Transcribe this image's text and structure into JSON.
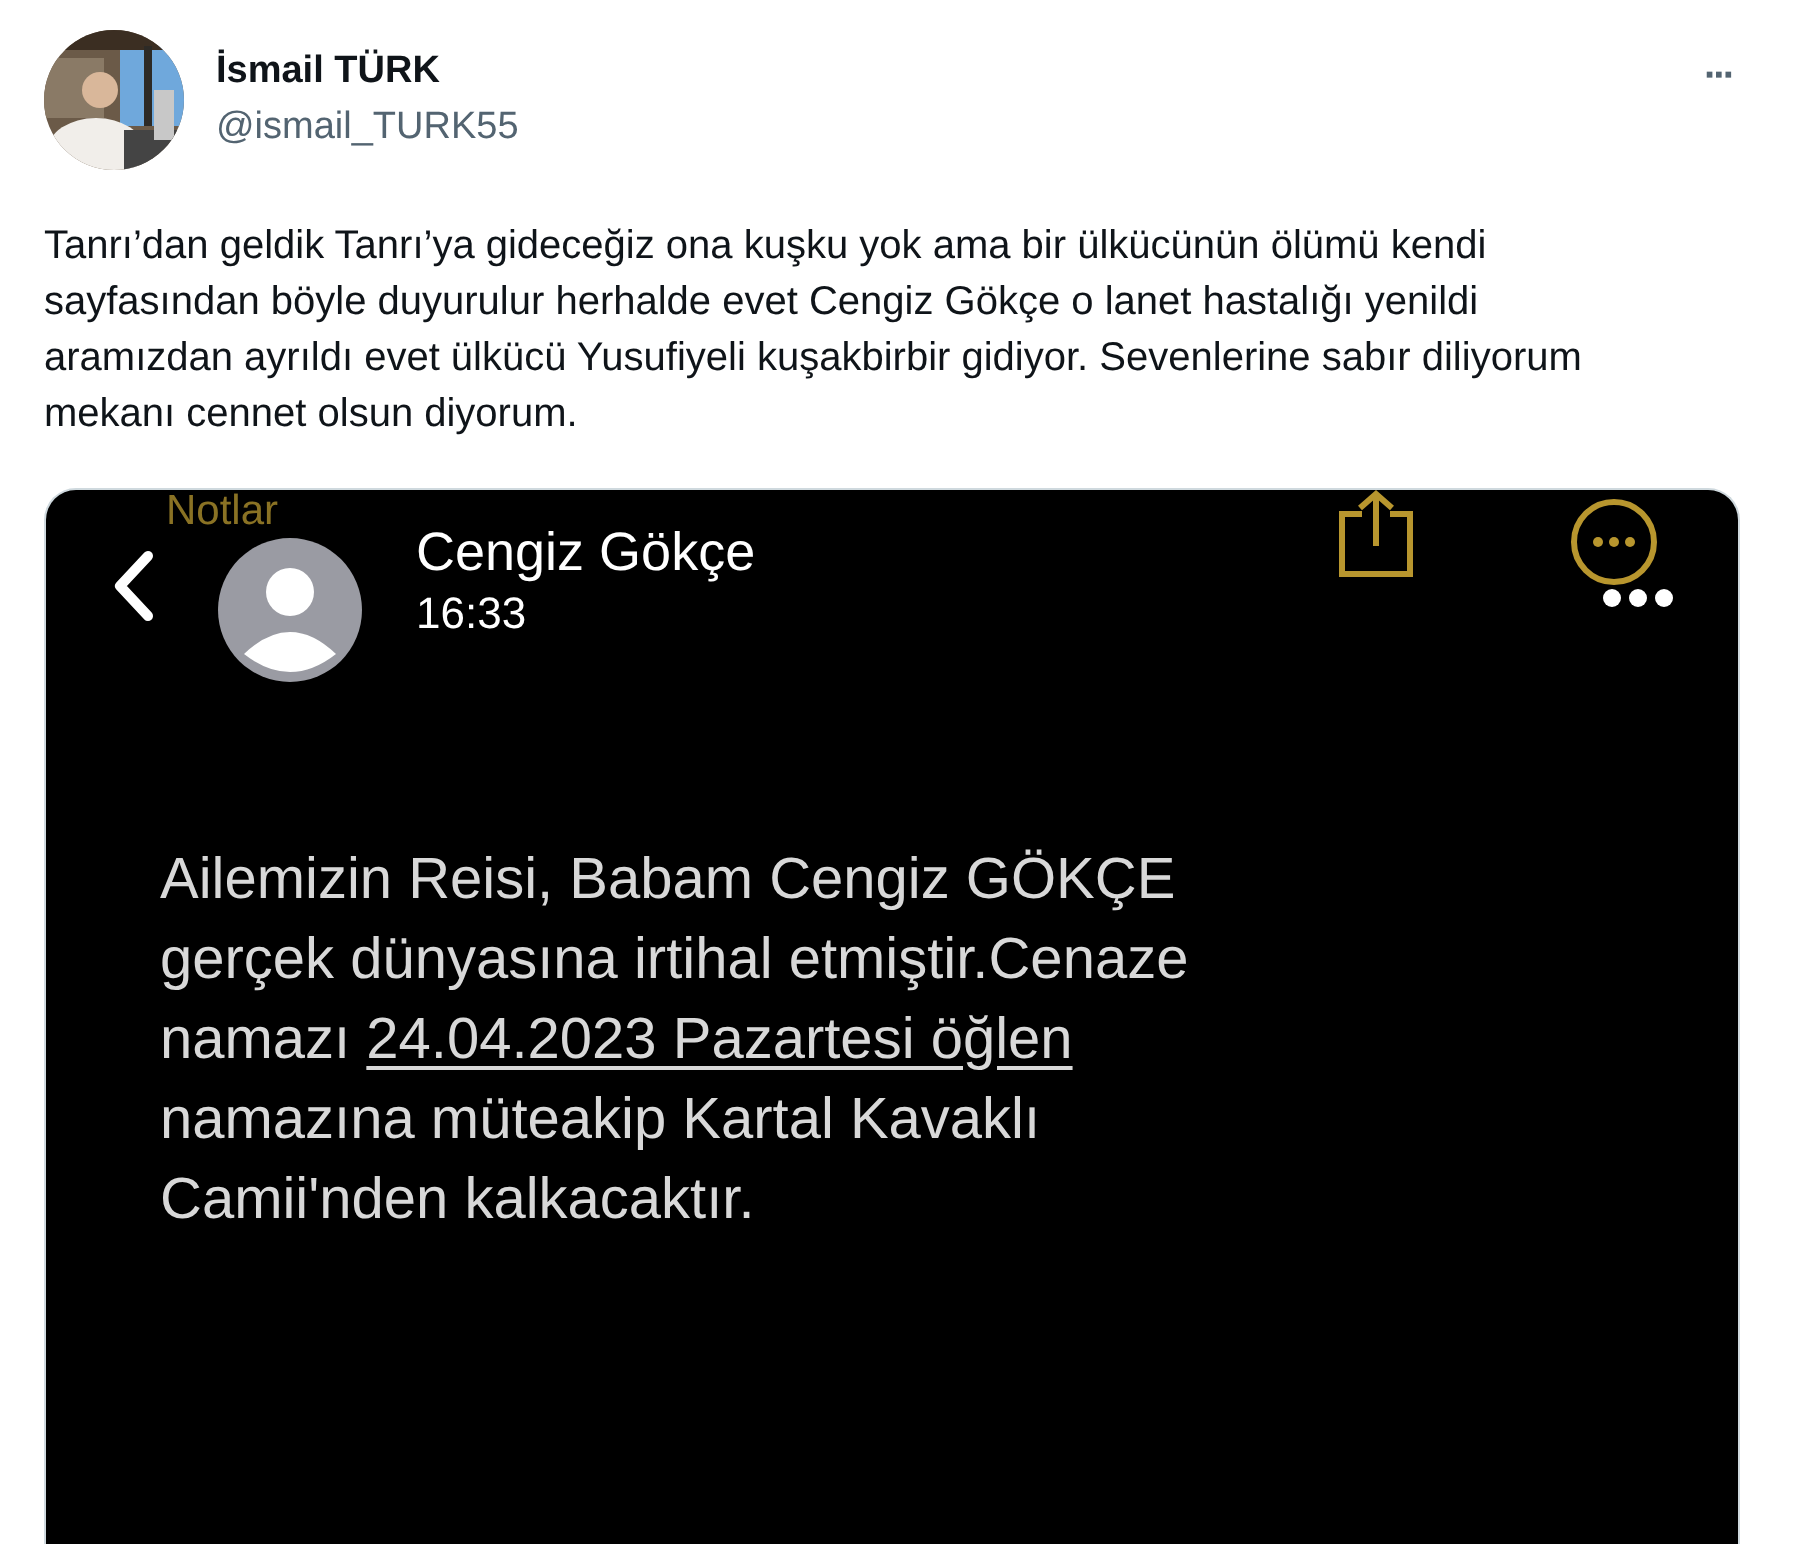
{
  "author": {
    "name": "İsmail TÜRK",
    "handle": "@ismail_TURK55"
  },
  "more_button": "···",
  "tweet_text": "Tanrı’dan geldik Tanrı’ya gideceğiz ona kuşku yok ama bir ülkücünün ölümü kendi sayfasından böyle duyurulur herhalde evet Cengiz Gökçe o lanet hastalığı yenildi aramızdan ayrıldı evet ülkücü Yusufiyeli kuşakbirbir gidiyor. Sevenlerine sabır diliyorum mekanı cennet olsun diyorum.",
  "screenshot": {
    "back_label": "Notlar",
    "contact_name": "Cengiz Gökçe",
    "time": "16:33",
    "message_lines": [
      [
        {
          "text": "Ailemizin Reisi, Babam Cengiz GÖKÇE",
          "underlined": false
        }
      ],
      [
        {
          "text": "gerçek dünyasına irtihal etmiştir.Cenaze",
          "underlined": false
        }
      ],
      [
        {
          "text": "namazı ",
          "underlined": false
        },
        {
          "text": "24.04.2023 Pazartesi öğlen",
          "underlined": true
        }
      ],
      [
        {
          "text": "namazına müteakip Kartal Kavaklı",
          "underlined": false
        }
      ],
      [
        {
          "text": "Camii'nden kalkacaktır.",
          "underlined": false
        }
      ]
    ]
  }
}
